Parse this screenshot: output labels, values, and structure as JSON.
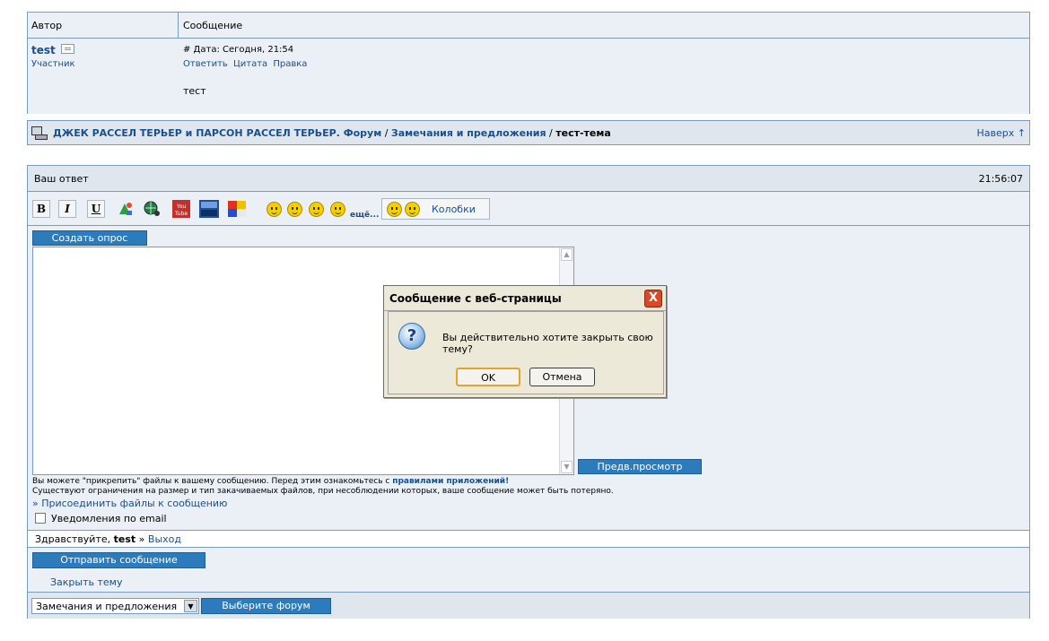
{
  "post_table": {
    "col_author": "Автор",
    "col_message": "Сообщение",
    "author_name": "test",
    "author_role": "Участник",
    "date": "# Дата: Сегодня, 21:54",
    "actions": [
      "Ответить",
      "Цитата",
      "Правка"
    ],
    "text": "тест"
  },
  "breadcrumb": {
    "forum": "ДЖЕК РАССЕЛ ТЕРЬЕР и ПАРСОН РАССЕЛ ТЕРЬЕР. Форум",
    "sep": " / ",
    "section": "Замечания и предложения",
    "current": "тест-тема",
    "to_top": "Наверх ↑"
  },
  "reply": {
    "title": "Ваш ответ",
    "time": "21:56:07",
    "toolbar": {
      "bold": "B",
      "italic": "I",
      "underline": "U",
      "more_smiles": "ещё...",
      "kolobki": "Колобки"
    },
    "create_poll": "Создать опрос",
    "preview": "Предв.просмотр",
    "info_line1_pre": "Вы можете \"прикрепить\" файлы к вашему сообщению. Перед этим ознакомьтесь с ",
    "info_line1_link": "правилами приложений!",
    "info_line2": "Существуют ограничения на размер и тип закачиваемых файлов, при несоблюдении которых, ваше сообщение может быть потеряно.",
    "attach_files": "» Присоединить файлы к сообщению",
    "email_notify": "Уведомления по email",
    "greeting": "Здравствуйте, ",
    "greeting_user": "test",
    "greeting_sep": " » ",
    "logout": "Выход",
    "send": "Отправить сообщение",
    "close_topic": "Закрыть тему",
    "forum_select": "Замечания и предложения",
    "choose_forum": "Выберите форум"
  },
  "dialog": {
    "title": "Сообщение с веб-страницы",
    "message": "Вы действительно хотите закрыть свою тему?",
    "ok": "OK",
    "cancel": "Отмена",
    "close_glyph": "X",
    "icon_glyph": "?"
  }
}
